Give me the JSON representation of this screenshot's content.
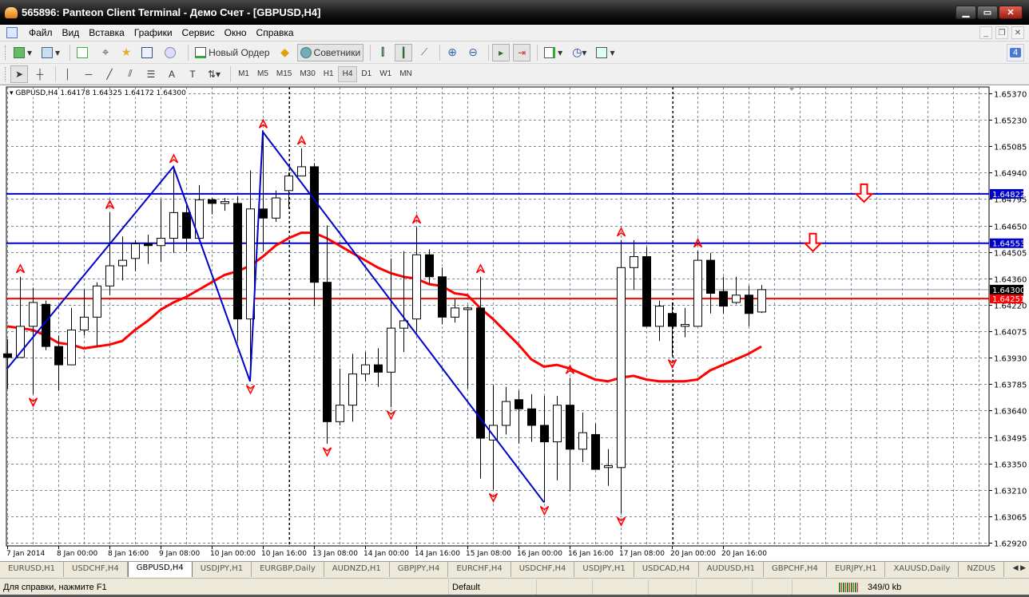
{
  "window": {
    "title": "565896: Panteon Client Terminal - Демо Счет - [GBPUSD,H4]",
    "minimize": "▁",
    "maximize": "▭",
    "close": "✕"
  },
  "menu": [
    "Файл",
    "Вид",
    "Вставка",
    "Графики",
    "Сервис",
    "Окно",
    "Справка"
  ],
  "mdi": {
    "minimize": "_",
    "restore": "❐",
    "close": "✕"
  },
  "toolbar": {
    "new_order": "Новый Ордер",
    "experts": "Советники",
    "notifications": "4"
  },
  "timeframes": [
    "M1",
    "M5",
    "M15",
    "M30",
    "H1",
    "H4",
    "D1",
    "W1",
    "MN"
  ],
  "active_timeframe": "H4",
  "chart": {
    "legend": "GBPUSD,H4  1.64178 1.64325 1.64172 1.64300",
    "price_ticks": [
      "1.65370",
      "1.65230",
      "1.65085",
      "1.64940",
      "1.64795",
      "1.64650",
      "1.64505",
      "1.64360",
      "1.64220",
      "1.64075",
      "1.63930",
      "1.63785",
      "1.63640",
      "1.63495",
      "1.63350",
      "1.63210",
      "1.63065",
      "1.62920"
    ],
    "price_range": [
      1.6292,
      1.6537
    ],
    "time_labels": [
      "7 Jan 2014",
      "8 Jan 00:00",
      "8 Jan 16:00",
      "9 Jan 08:00",
      "10 Jan 00:00",
      "10 Jan 16:00",
      "13 Jan 08:00",
      "14 Jan 00:00",
      "14 Jan 16:00",
      "15 Jan 08:00",
      "16 Jan 00:00",
      "16 Jan 16:00",
      "17 Jan 08:00",
      "20 Jan 00:00",
      "20 Jan 16:00"
    ],
    "candles": [
      [
        1.6395,
        1.6403,
        1.6376,
        1.6393
      ],
      [
        1.6393,
        1.6437,
        1.6393,
        1.641
      ],
      [
        1.641,
        1.6431,
        1.6373,
        1.6423
      ],
      [
        1.6422,
        1.6424,
        1.6397,
        1.6399
      ],
      [
        1.6399,
        1.6405,
        1.6375,
        1.6389
      ],
      [
        1.6389,
        1.642,
        1.6389,
        1.6408
      ],
      [
        1.6408,
        1.643,
        1.6405,
        1.6415
      ],
      [
        1.6415,
        1.6434,
        1.6399,
        1.6432
      ],
      [
        1.6432,
        1.6472,
        1.6427,
        1.6443
      ],
      [
        1.6443,
        1.6459,
        1.6435,
        1.6446
      ],
      [
        1.6447,
        1.6457,
        1.644,
        1.6455
      ],
      [
        1.6455,
        1.646,
        1.6444,
        1.6454
      ],
      [
        1.6454,
        1.6479,
        1.6445,
        1.6458
      ],
      [
        1.6458,
        1.6497,
        1.645,
        1.6472
      ],
      [
        1.6472,
        1.6477,
        1.6451,
        1.6458
      ],
      [
        1.6458,
        1.6487,
        1.6458,
        1.6479
      ],
      [
        1.6479,
        1.648,
        1.6471,
        1.6477
      ],
      [
        1.6477,
        1.648,
        1.6473,
        1.6478
      ],
      [
        1.6477,
        1.6481,
        1.6402,
        1.6414
      ],
      [
        1.6414,
        1.6495,
        1.638,
        1.6474
      ],
      [
        1.6474,
        1.6516,
        1.6451,
        1.6469
      ],
      [
        1.6469,
        1.6484,
        1.6467,
        1.648
      ],
      [
        1.6484,
        1.6494,
        1.6474,
        1.6492
      ],
      [
        1.6492,
        1.6507,
        1.6492,
        1.6497
      ],
      [
        1.6497,
        1.6499,
        1.6421,
        1.6434
      ],
      [
        1.6434,
        1.6465,
        1.6346,
        1.6358
      ],
      [
        1.6358,
        1.6387,
        1.6356,
        1.6367
      ],
      [
        1.6367,
        1.6395,
        1.6358,
        1.6384
      ],
      [
        1.6384,
        1.6396,
        1.638,
        1.6389
      ],
      [
        1.6389,
        1.6398,
        1.6377,
        1.6385
      ],
      [
        1.6385,
        1.6447,
        1.6366,
        1.6409
      ],
      [
        1.6409,
        1.6451,
        1.6396,
        1.6413
      ],
      [
        1.6414,
        1.6464,
        1.6407,
        1.6449
      ],
      [
        1.6449,
        1.6452,
        1.6433,
        1.6437
      ],
      [
        1.6437,
        1.6442,
        1.6411,
        1.6415
      ],
      [
        1.6415,
        1.6425,
        1.6412,
        1.642
      ],
      [
        1.642,
        1.6421,
        1.6376,
        1.642
      ],
      [
        1.642,
        1.6437,
        1.6327,
        1.6349
      ],
      [
        1.6348,
        1.6378,
        1.6321,
        1.6356
      ],
      [
        1.6356,
        1.6377,
        1.6351,
        1.6369
      ],
      [
        1.637,
        1.6375,
        1.6346,
        1.6365
      ],
      [
        1.6365,
        1.6373,
        1.6347,
        1.6356
      ],
      [
        1.6356,
        1.6372,
        1.6314,
        1.6347
      ],
      [
        1.6347,
        1.6372,
        1.6326,
        1.6367
      ],
      [
        1.6367,
        1.6382,
        1.632,
        1.6343
      ],
      [
        1.6343,
        1.6363,
        1.6336,
        1.6352
      ],
      [
        1.6351,
        1.6357,
        1.6332,
        1.6332
      ],
      [
        1.6333,
        1.6343,
        1.6323,
        1.6334
      ],
      [
        1.6333,
        1.6457,
        1.6308,
        1.6442
      ],
      [
        1.6442,
        1.6457,
        1.643,
        1.6448
      ],
      [
        1.6448,
        1.6453,
        1.641,
        1.641
      ],
      [
        1.641,
        1.6424,
        1.6402,
        1.6421
      ],
      [
        1.6417,
        1.6423,
        1.6394,
        1.641
      ],
      [
        1.641,
        1.642,
        1.6404,
        1.6411
      ],
      [
        1.641,
        1.6451,
        1.641,
        1.6446
      ],
      [
        1.6446,
        1.645,
        1.6417,
        1.6428
      ],
      [
        1.6429,
        1.6437,
        1.6417,
        1.6421
      ],
      [
        1.6423,
        1.6437,
        1.6422,
        1.6427
      ],
      [
        1.6427,
        1.6432,
        1.641,
        1.6417
      ],
      [
        1.64178,
        1.64325,
        1.64172,
        1.643
      ]
    ],
    "ma": [
      1.641,
      1.6409,
      1.6408,
      1.6405,
      1.6401,
      1.64,
      1.6398,
      1.6399,
      1.64,
      1.6402,
      1.6408,
      1.6413,
      1.6419,
      1.6423,
      1.6426,
      1.643,
      1.6434,
      1.6438,
      1.644,
      1.6443,
      1.6448,
      1.6454,
      1.6458,
      1.6461,
      1.6461,
      1.6458,
      1.6454,
      1.645,
      1.6446,
      1.6442,
      1.6439,
      1.6437,
      1.6436,
      1.6433,
      1.6432,
      1.6428,
      1.6427,
      1.642,
      1.6414,
      1.6407,
      1.64,
      1.6392,
      1.6388,
      1.6389,
      1.6387,
      1.6384,
      1.6381,
      1.638,
      1.6382,
      1.6383,
      1.6381,
      1.638,
      1.638,
      1.638,
      1.6381,
      1.6386,
      1.6389,
      1.6392,
      1.6395,
      1.6399
    ],
    "zigzag": [
      [
        0,
        1.6387
      ],
      [
        13,
        1.6497
      ],
      [
        19,
        1.638
      ],
      [
        20,
        1.6516
      ],
      [
        42,
        1.6314
      ]
    ],
    "fractals_up": [
      1,
      8,
      13,
      20,
      23,
      32,
      37,
      44,
      48,
      54
    ],
    "fractals_down": [
      2,
      19,
      25,
      30,
      38,
      42,
      48,
      52
    ],
    "levels": [
      {
        "price": 1.64822,
        "label": "1.64822",
        "color": "#0000cc"
      },
      {
        "price": 1.64553,
        "label": "1.64553",
        "color": "#0000cc"
      },
      {
        "price": 1.64251,
        "label": "1.64251",
        "color": "#ff0000"
      }
    ],
    "bid": {
      "price": 1.643,
      "label": "1.64300"
    },
    "sell_arrows": [
      {
        "bar": 67,
        "price": 1.64822
      },
      {
        "bar": 63,
        "price": 1.64553
      }
    ],
    "separators": [
      22,
      52
    ],
    "colors": {
      "ma": "#ff0000",
      "zigzag": "#0000cc",
      "fractal": "#ff0000",
      "grid": "#778899"
    }
  },
  "tabs": [
    "EURUSD,H1",
    "USDCHF,H4",
    "GBPUSD,H4",
    "USDJPY,H1",
    "EURGBP,Daily",
    "AUDNZD,H1",
    "GBPJPY,H4",
    "EURCHF,H4",
    "USDCHF,H4",
    "USDJPY,H1",
    "USDCAD,H4",
    "AUDUSD,H1",
    "GBPCHF,H4",
    "EURJPY,H1",
    "XAUUSD,Daily",
    "NZDUS"
  ],
  "active_tab": "GBPUSD,H4",
  "tab_arrows": "◀ ▶",
  "status": {
    "help": "Для справки, нажмите F1",
    "profile": "Default",
    "traffic": "349/0 kb"
  }
}
